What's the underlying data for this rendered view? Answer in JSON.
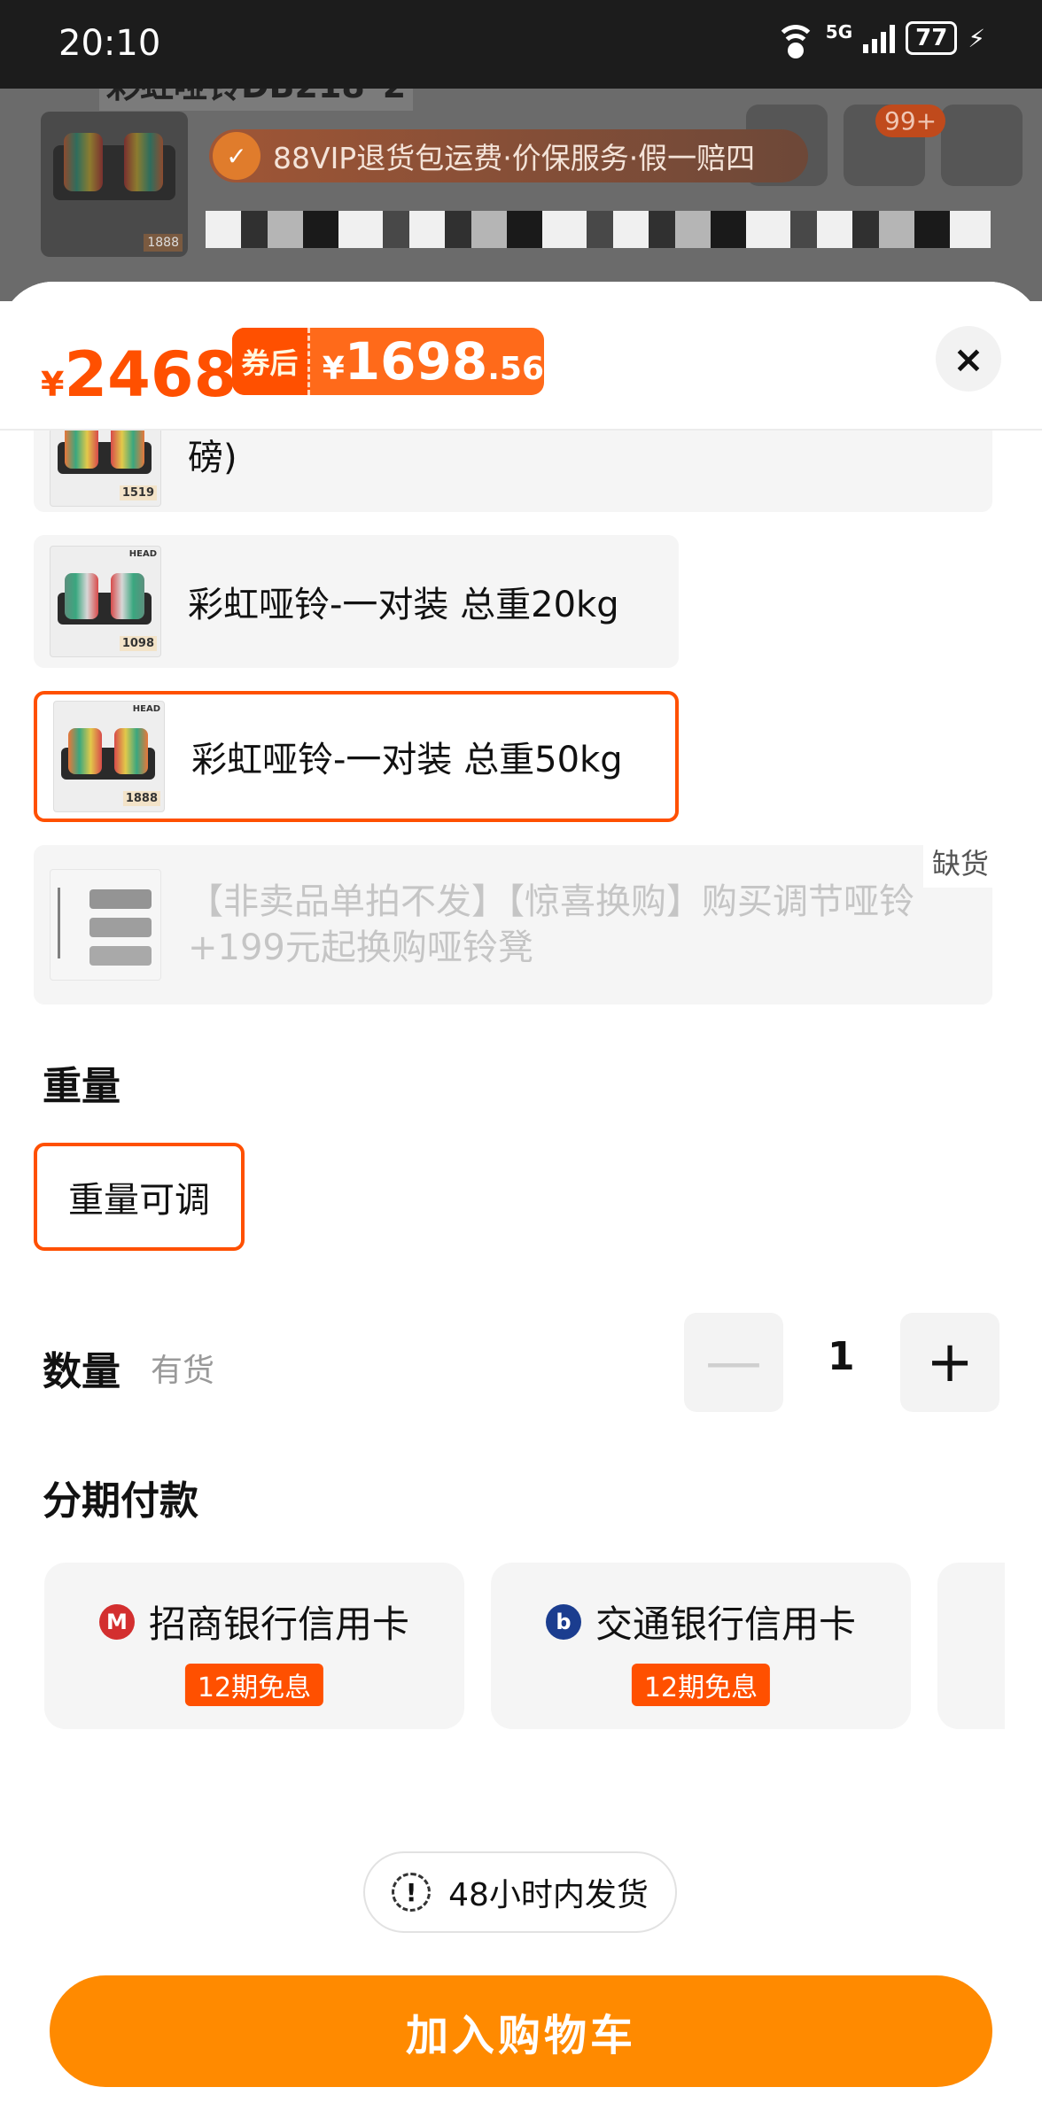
{
  "status_bar": {
    "time": "20:10",
    "network": "5G",
    "battery": "77"
  },
  "background_page": {
    "title": "彩虹哑铃DB218*2",
    "cart_badge": "99+",
    "vip_banner": "88VIP退货包运费·价保服务·假一赔四"
  },
  "sheet": {
    "price": {
      "currency": "¥",
      "value": "2468"
    },
    "coupon": {
      "tag": "券后",
      "currency": "¥",
      "integer": "1698",
      "decimal": ".56"
    },
    "close_icon": "×",
    "options": [
      {
        "label": "磅)",
        "state": "normal",
        "thumb_price": "1519"
      },
      {
        "label": "彩虹哑铃-一对装 总重20kg",
        "state": "normal",
        "thumb_price": "1098"
      },
      {
        "label": "彩虹哑铃-一对装 总重50kg",
        "state": "selected",
        "thumb_price": "1888"
      },
      {
        "label": "【非卖品单拍不发】【惊喜换购】购买调节哑铃+199元起换购哑铃凳",
        "state": "out_of_stock",
        "oos_tag": "缺货"
      }
    ],
    "weight": {
      "title": "重量",
      "option": "重量可调"
    },
    "quantity": {
      "title": "数量",
      "stock": "有货",
      "minus": "—",
      "value": "1",
      "plus": "+"
    },
    "installment": {
      "title": "分期付款",
      "banks": [
        {
          "name": "招商银行信用卡",
          "tag": "12期免息",
          "logo_color": "#d32f2f",
          "icon": "cmb-logo-icon"
        },
        {
          "name": "交通银行信用卡",
          "tag": "12期免息",
          "logo_color": "#1b3d8f",
          "icon": "bocom-logo-icon"
        }
      ]
    },
    "shipping_note": "48小时内发货",
    "add_to_cart": "加入购物车"
  },
  "colors": {
    "accent": "#ff5000",
    "cta": "#ff8a00"
  }
}
